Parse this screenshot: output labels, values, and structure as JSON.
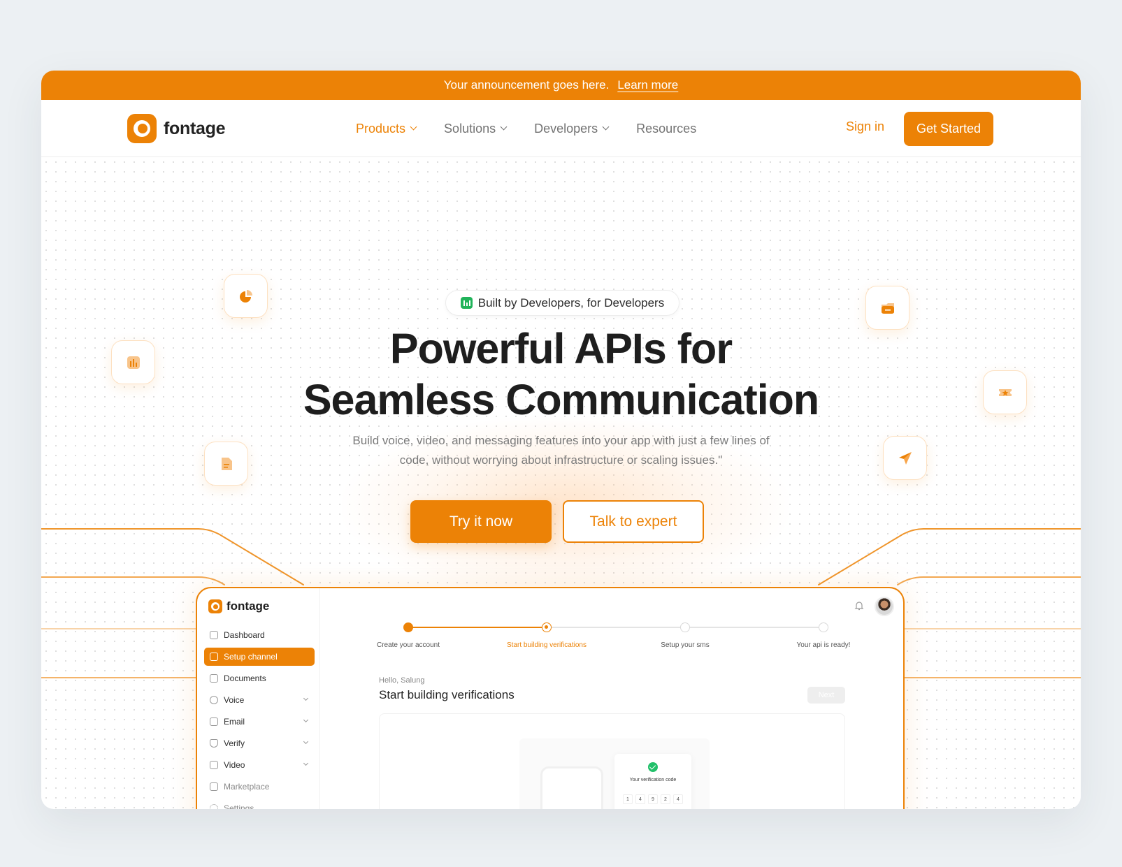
{
  "announcement": {
    "text": "Your announcement goes here.",
    "link": "Learn more"
  },
  "brand": {
    "name": "fontage",
    "accent": "#ec8206"
  },
  "nav": {
    "items": [
      {
        "label": "Products",
        "dropdown": true,
        "active": true
      },
      {
        "label": "Solutions",
        "dropdown": true
      },
      {
        "label": "Developers",
        "dropdown": true
      },
      {
        "label": "Resources",
        "dropdown": false
      }
    ],
    "sign_in": "Sign in",
    "get_started": "Get Started"
  },
  "hero": {
    "badge": "Built by Developers, for Developers",
    "title_line1": "Powerful APIs for",
    "title_line2": "Seamless Communication",
    "subtitle_line1": "Build voice, video, and messaging features into your app with just a few lines of",
    "subtitle_line2": "code, without worrying about infrastructure or scaling issues.\"",
    "primary_cta": "Try it now",
    "secondary_cta": "Talk to expert",
    "floating_icons": [
      "pie-chart-icon",
      "bar-chart-icon",
      "document-icon",
      "folder-icon",
      "ticket-icon",
      "send-icon"
    ]
  },
  "dashboard": {
    "brand": "fontage",
    "sidebar": [
      {
        "label": "Dashboard",
        "icon": "home-icon"
      },
      {
        "label": "Setup channel",
        "icon": "grid-icon",
        "active": true
      },
      {
        "label": "Documents",
        "icon": "document-icon"
      },
      {
        "label": "Voice",
        "icon": "mic-icon",
        "expandable": true
      },
      {
        "label": "Email",
        "icon": "mail-icon",
        "expandable": true
      },
      {
        "label": "Verify",
        "icon": "shield-icon",
        "expandable": true
      },
      {
        "label": "Video",
        "icon": "video-icon",
        "expandable": true
      },
      {
        "label": "Marketplace",
        "icon": "bag-icon"
      },
      {
        "label": "Settings",
        "icon": "gear-icon"
      }
    ],
    "steps": [
      {
        "label": "Create your account",
        "state": "done"
      },
      {
        "label": "Start building verifications",
        "state": "current"
      },
      {
        "label": "Setup your sms",
        "state": "todo"
      },
      {
        "label": "Your api is ready!",
        "state": "todo"
      }
    ],
    "greeting": "Hello, Salung",
    "title": "Start building verifications",
    "next": "Next",
    "verification": {
      "title": "Your verification code",
      "digits": [
        "1",
        "4",
        "9",
        "2",
        "4"
      ]
    }
  }
}
